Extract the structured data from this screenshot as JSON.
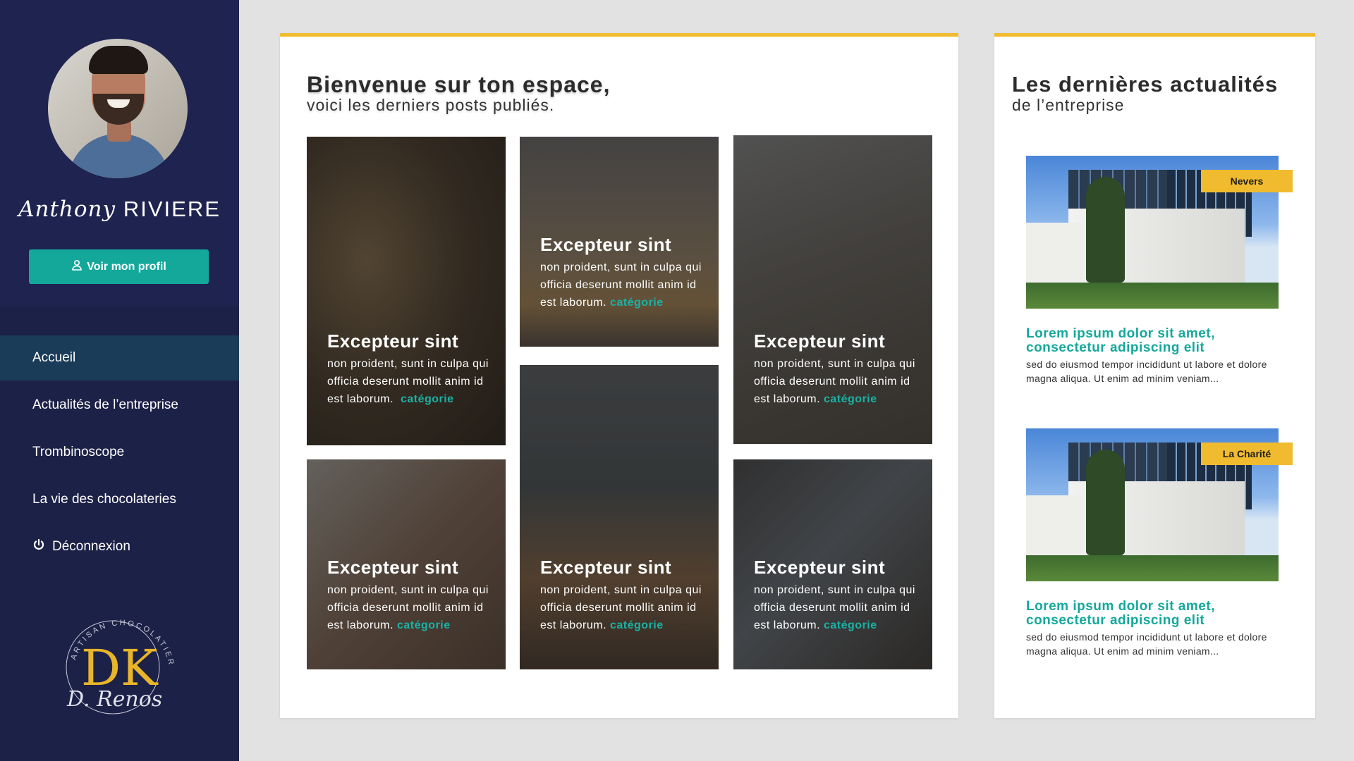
{
  "colors": {
    "sidebar": "#1c2147",
    "accent_teal": "#14a89b",
    "accent_yellow": "#f0bb2e",
    "background": "#e2e2e2"
  },
  "user": {
    "first_name": "Anthony",
    "last_name": "RIVIERE",
    "profile_button": "Voir mon profil",
    "profile_icon": "user-icon"
  },
  "nav": {
    "items": [
      {
        "label": "Accueil",
        "active": true
      },
      {
        "label": "Actualités de l’entreprise",
        "active": false
      },
      {
        "label": "Trombinoscope",
        "active": false
      },
      {
        "label": "La vie des chocolateries",
        "active": false
      },
      {
        "label": "Déconnexion",
        "active": false,
        "icon": "power-icon"
      }
    ]
  },
  "logo": {
    "monogram": "DK",
    "arc_text": "ARTISAN CHOCOLATIER",
    "signature": "D. Renos"
  },
  "main": {
    "title": "Bienvenue sur ton espace,",
    "subtitle": "voici les derniers posts publiés.",
    "posts": [
      {
        "title": "Excepteur sint",
        "body": "non proident, sunt in culpa qui officia deserunt mollit anim id est laborum.",
        "category": "catégorie"
      },
      {
        "title": "Excepteur sint",
        "body": "non proident, sunt in culpa qui officia deserunt mollit anim id est laborum.",
        "category": "catégorie"
      },
      {
        "title": "Excepteur sint",
        "body": "non proident, sunt in culpa qui officia deserunt mollit anim id est laborum.",
        "category": "catégorie"
      },
      {
        "title": "Excepteur sint",
        "body": "non proident, sunt in culpa qui officia deserunt mollit anim id est laborum.",
        "category": "catégorie"
      },
      {
        "title": "Excepteur sint",
        "body": "non proident, sunt in culpa qui officia deserunt mollit anim id est laborum.",
        "category": "catégorie"
      },
      {
        "title": "Excepteur sint",
        "body": "non proident, sunt in culpa qui officia deserunt mollit anim id est laborum.",
        "category": "catégorie"
      }
    ]
  },
  "news": {
    "title": "Les dernières actualités",
    "subtitle": "de l’entreprise",
    "items": [
      {
        "badge": "Nevers",
        "headline": "Lorem ipsum dolor sit amet, consectetur adipiscing elit",
        "excerpt": "sed do eiusmod tempor incididunt ut labore et dolore magna aliqua. Ut enim ad minim veniam..."
      },
      {
        "badge": "La Charité",
        "headline": "Lorem ipsum dolor sit amet, consectetur adipiscing elit",
        "excerpt": "sed do eiusmod tempor incididunt ut labore et dolore magna aliqua. Ut enim ad minim veniam..."
      }
    ]
  }
}
